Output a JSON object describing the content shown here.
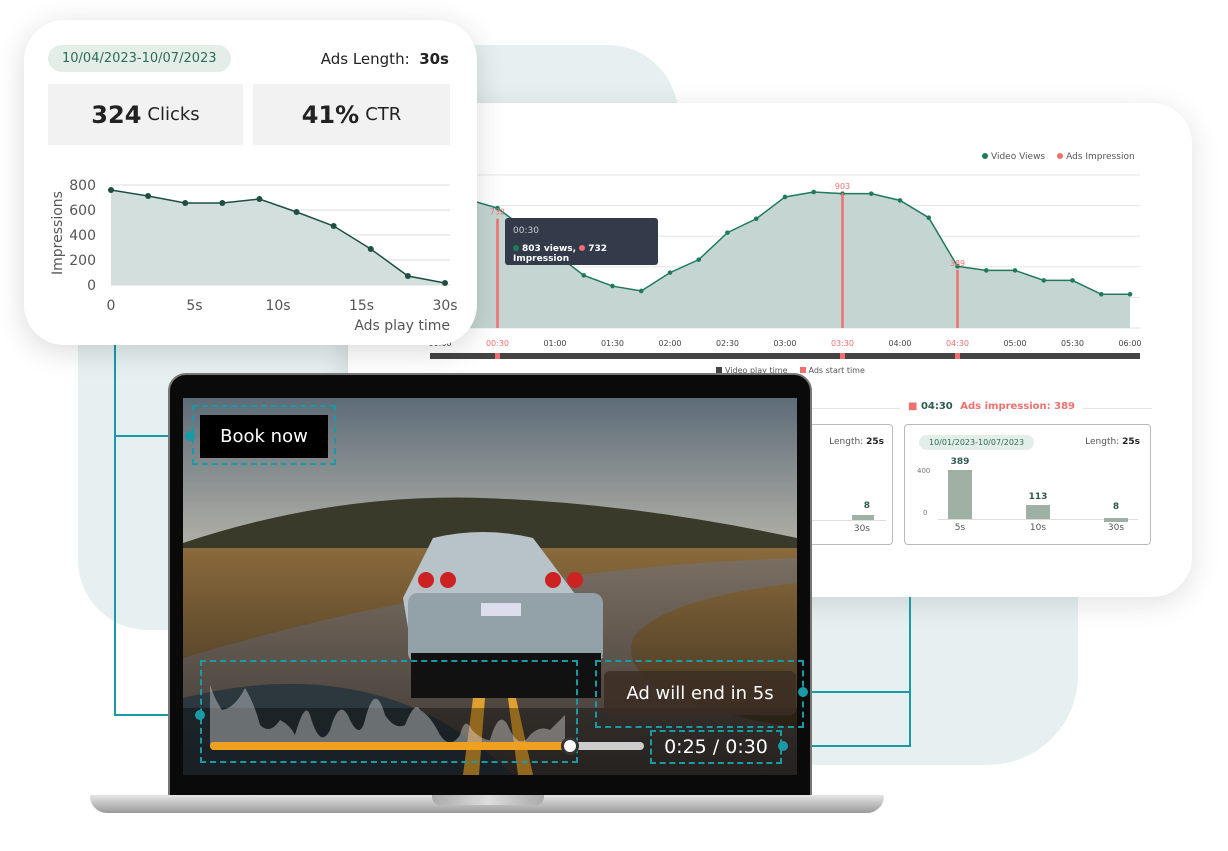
{
  "colors": {
    "accent": "#1a9aa6",
    "views": "#1f7a5c",
    "impression": "#f07070",
    "fill": "#c5d6d2",
    "progress": "#f0a020"
  },
  "left_card": {
    "date_range": "10/04/2023-10/07/2023",
    "length_label": "Ads Length:",
    "length_value": "30s",
    "clicks_value": "324",
    "clicks_label": "Clicks",
    "ctr_value": "41%",
    "ctr_label": "CTR"
  },
  "right_card": {
    "legend": {
      "views": "Video Views",
      "impression": "Ads Impression"
    },
    "tooltip": {
      "time": "00:30",
      "views": "803 views,",
      "impression": "732 Impression"
    },
    "time_labels": [
      "00:00",
      "00:30",
      "01:00",
      "01:30",
      "02:00",
      "02:30",
      "03:00",
      "03:30",
      "04:00",
      "04:30",
      "05:00",
      "05:30",
      "06:00"
    ],
    "ad_times": [
      "00:30",
      "03:30",
      "04:30"
    ],
    "timeline_legend": {
      "play": "Video play time",
      "ads": "Ads start time"
    },
    "section": {
      "time": "04:30",
      "label": "Ads impression:",
      "value": "389"
    },
    "card_partial": {
      "length_label": "Length:",
      "length_value": "25s",
      "bar_value": "8",
      "bar_label": "30s"
    },
    "card_full": {
      "date_range": "10/01/2023-10/07/2023",
      "length_label": "Length:",
      "length_value": "25s",
      "y_ticks": [
        "400",
        "0"
      ]
    }
  },
  "video": {
    "cta": "Book now",
    "ad_end": "Ad will end in 5s",
    "time": "0:25 / 0:30",
    "progress": 0.83
  },
  "chart_data": [
    {
      "type": "area",
      "title": "",
      "xlabel": "Ads play time",
      "ylabel": "Impressions",
      "ylim": [
        0,
        800
      ],
      "y_ticks": [
        "800",
        "600",
        "400",
        "200",
        "0"
      ],
      "x_ticks": [
        "0",
        "5s",
        "10s",
        "15s",
        "30s"
      ],
      "x": [
        0,
        1,
        2,
        3,
        4,
        5,
        6,
        7,
        8,
        9
      ],
      "values": [
        760,
        712,
        656,
        656,
        688,
        584,
        472,
        288,
        72,
        16
      ],
      "grid": true
    },
    {
      "type": "area",
      "xlabel": "",
      "ylabel": "",
      "grid": true,
      "x": [
        "00:00",
        "00:15",
        "00:30",
        "00:45",
        "01:00",
        "01:15",
        "01:30",
        "01:45",
        "02:00",
        "02:15",
        "02:30",
        "02:45",
        "03:00",
        "03:15",
        "03:30",
        "03:45",
        "04:00",
        "04:15",
        "04:30",
        "04:45",
        "05:00",
        "05:15",
        "05:30",
        "05:45",
        "06:00"
      ],
      "series": [
        {
          "name": "Video Views",
          "values": [
            880,
            860,
            803,
            660,
            500,
            353,
            281,
            248,
            371,
            458,
            639,
            732,
            878,
            911,
            900,
            900,
            855,
            739,
            413,
            386,
            386,
            319,
            319,
            226,
            226
          ]
        },
        {
          "name": "Ads Impression",
          "points": [
            {
              "x": "00:30",
              "y": 732
            },
            {
              "x": "03:30",
              "y": 903
            },
            {
              "x": "04:30",
              "y": 389
            }
          ]
        }
      ]
    },
    {
      "type": "bar",
      "categories": [
        "5s",
        "10s",
        "30s"
      ],
      "values": [
        389,
        113,
        8
      ],
      "ylim": [
        0,
        400
      ]
    }
  ]
}
